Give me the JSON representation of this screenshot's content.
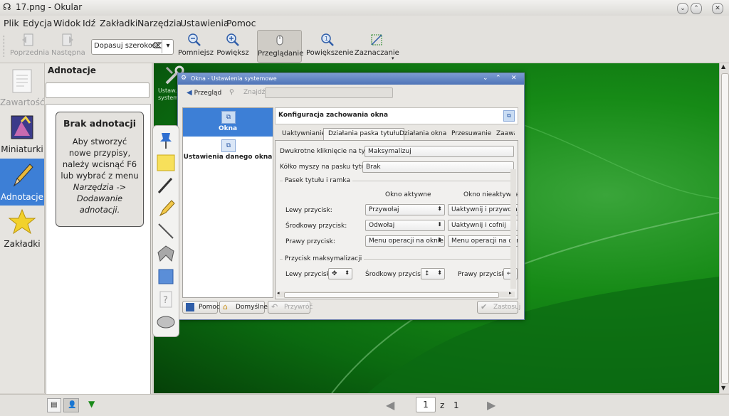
{
  "window": {
    "title": "17.png - Okular"
  },
  "menubar": [
    "Plik",
    "Edycja",
    "Widok",
    "Idź",
    "Zakładki",
    "Narzędzia",
    "Ustawienia",
    "Pomoc"
  ],
  "toolbar": {
    "prev": "Poprzednia",
    "next": "Następna",
    "zoom_value": "Dopasuj szerokość",
    "zoom_out": "Pomniejsz",
    "zoom_in": "Powiększ",
    "browse": "Przeglądanie",
    "magnify": "Powiększenie",
    "select": "Zaznaczanie"
  },
  "sidebar": {
    "tabs": [
      {
        "label": "Zawartość",
        "icon": "document-icon",
        "state": "disabled"
      },
      {
        "label": "Miniaturki",
        "icon": "thumbnails-icon",
        "state": "normal"
      },
      {
        "label": "Adnotacje",
        "icon": "pencil-icon",
        "state": "selected"
      },
      {
        "label": "Zakładki",
        "icon": "star-icon",
        "state": "normal"
      }
    ]
  },
  "annotations": {
    "header": "Adnotacje",
    "search_value": "",
    "empty_title": "Brak adnotacji",
    "empty_text_1": "Aby stworzyć nowe przypisy, należy wcisnąć F6 lub wybrać z menu",
    "empty_text_2": "Narzędzia -> Dodawanie adnotacji."
  },
  "desktop_icon_label": "Ustaw. systemu",
  "dialog": {
    "title": "Okna - Ustawienia systemowe",
    "back": "Przegląd",
    "search_label": "Znajdź:",
    "search_value": "",
    "nav": [
      "Okna",
      "Ustawienia danego okna"
    ],
    "header": "Konfiguracja zachowania okna",
    "tabs": [
      "Uaktywnianie",
      "Działania paska tytułu",
      "Działania okna",
      "Przesuwanie",
      "Zaawa"
    ],
    "dblclick_label": "Dwukrotne kliknięcie na tytule:",
    "dblclick_value": "Maksymalizuj",
    "wheel_label": "Kółko myszy na pasku tytułu:",
    "wheel_value": "Brak",
    "group1": "Pasek tytułu i ramka",
    "col_active": "Okno aktywne",
    "col_inactive": "Okno nieaktywne",
    "rows": [
      {
        "label": "Lewy przycisk:",
        "active": "Przywołaj",
        "inactive": "Uaktywnij i przywołaj"
      },
      {
        "label": "Środkowy przycisk:",
        "active": "Odwołaj",
        "inactive": "Uaktywnij i cofnij"
      },
      {
        "label": "Prawy przycisk:",
        "active": "Menu operacji na oknie",
        "inactive": "Menu operacji na oknie"
      }
    ],
    "group2": "Przycisk maksymalizacji",
    "max_left": "Lewy przycisk:",
    "max_mid": "Środkowy przycisk:",
    "max_right": "Prawy przycisk:",
    "btn_help": "Pomoc",
    "btn_defaults": "Domyślne",
    "btn_reset": "Przywróć",
    "btn_apply": "Zastosuj"
  },
  "statusbar": {
    "page": "1",
    "of": "z",
    "total": "1"
  },
  "colors": {
    "selection": "#3d7fd6",
    "dialog_title": "#5478b9",
    "desktop": "#168a16"
  }
}
